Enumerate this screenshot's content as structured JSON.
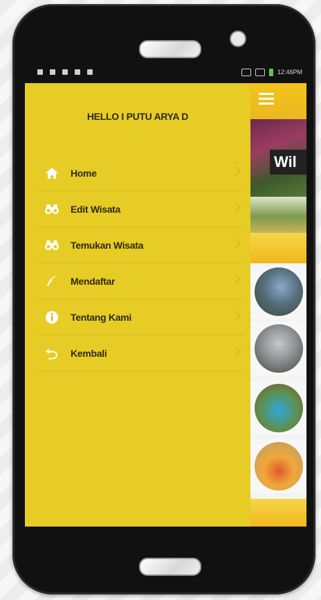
{
  "status_bar": {
    "time": "12:46",
    "time_suffix": "PM"
  },
  "drawer": {
    "greeting": "HELLO I PUTU ARYA D",
    "items": [
      {
        "label": "Home",
        "icon": "home-icon"
      },
      {
        "label": "Edit Wisata",
        "icon": "binoculars-icon"
      },
      {
        "label": "Temukan Wisata",
        "icon": "binoculars-icon"
      },
      {
        "label": "Mendaftar",
        "icon": "feather-icon"
      },
      {
        "label": "Tentang Kami",
        "icon": "info-icon"
      },
      {
        "label": "Kembali",
        "icon": "back-arrow-icon"
      }
    ]
  },
  "content": {
    "banner_text": "Wil"
  },
  "colors": {
    "drawer_bg": "#e7cc25",
    "accent_orange": "#efb81c",
    "text_dark": "#2f2a08"
  }
}
